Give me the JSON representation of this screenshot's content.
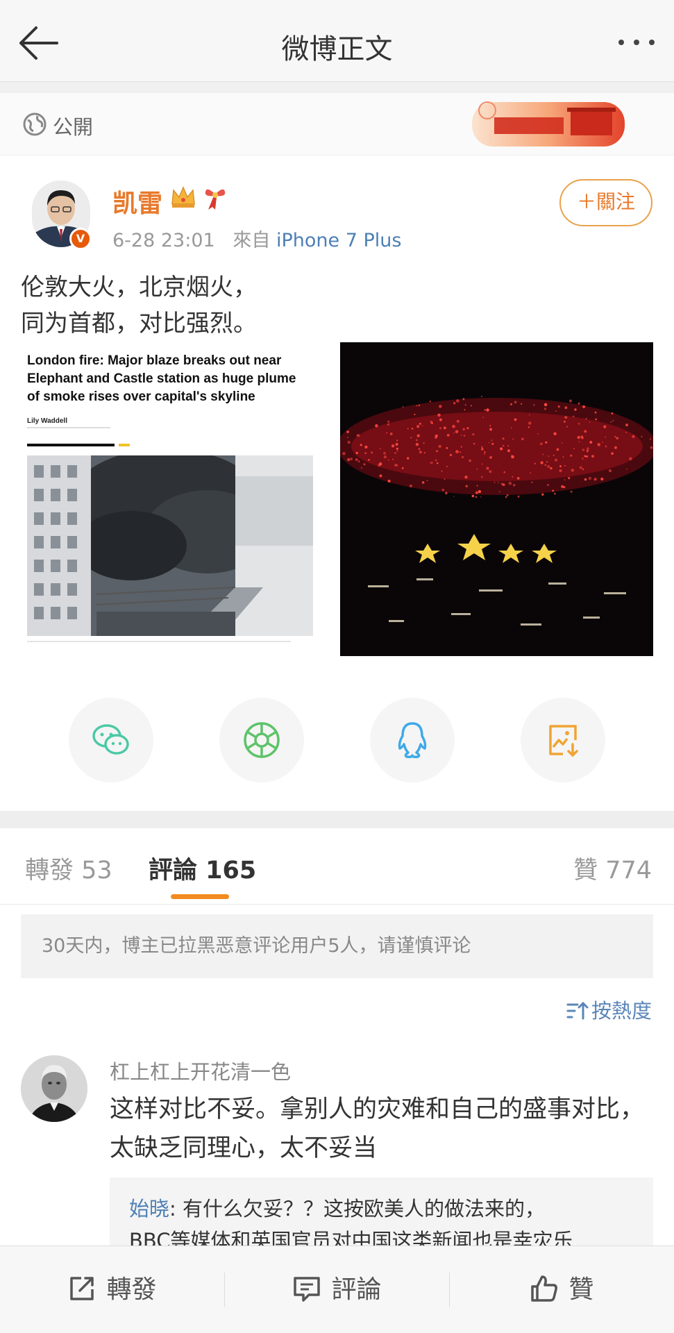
{
  "header": {
    "title": "微博正文"
  },
  "visibility": {
    "label": "公開"
  },
  "post": {
    "author": "凯雷",
    "time": "6-28 23:01",
    "from_label": "來自",
    "source": "iPhone 7 Plus",
    "follow_label": "＋關注",
    "text_line1": "伦敦大火，北京烟火，",
    "text_line2": "同为首都，对比强烈。",
    "image1": {
      "headline_line1": "London fire: Major blaze breaks out near",
      "headline_line2": "Elephant and Castle station as huge plume",
      "headline_line3": "of smoke rises over capital's skyline",
      "byline": "Lily Waddell"
    }
  },
  "share_icons": [
    "wechat-icon",
    "moments-icon",
    "qq-icon",
    "save-image-icon"
  ],
  "tabs": {
    "repost": "轉發 53",
    "comment": "評論 165",
    "like": "贊 774"
  },
  "notice": "30天内，博主已拉黑恶意评论用户5人，请谨慎评论",
  "sort_label": "按熱度",
  "comment": {
    "username": "杠上杠上开花清一色",
    "text": "这样对比不妥。拿别人的灾难和自己的盛事对比，太缺乏同理心，太不妥当",
    "reply_name": "始晓",
    "reply_text": ": 有什么欠妥？？这按欧美人的做法来的，",
    "reply_text2": "BBC等媒体和英国官员对中国这类新闻也是幸灾乐"
  },
  "bottom_bar": {
    "repost": "轉發",
    "comment": "評論",
    "like": "贊"
  },
  "colors": {
    "accent_orange": "#f28b20",
    "username_orange": "#e8792a",
    "link_blue": "#4d7fb5"
  }
}
